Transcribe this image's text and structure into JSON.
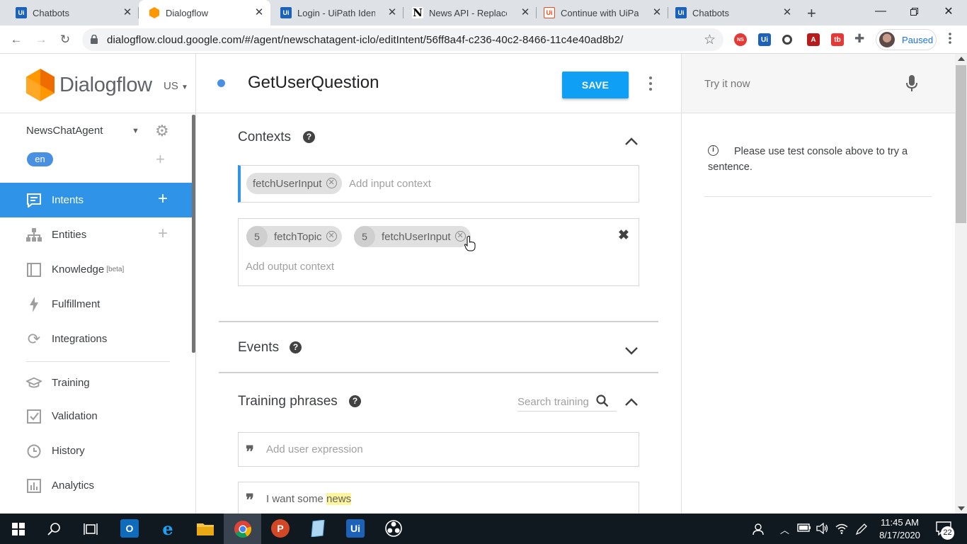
{
  "browser": {
    "tabs": [
      {
        "title": "Chatbots",
        "favicon": "uipath-icon",
        "active": false
      },
      {
        "title": "Dialogflow",
        "favicon": "dialogflow-icon",
        "active": true
      },
      {
        "title": "Login - UiPath Identi",
        "favicon": "uipath-icon",
        "active": false
      },
      {
        "title": "News API - Replacem",
        "favicon": "notion-icon",
        "active": false
      },
      {
        "title": "Continue with UiPat",
        "favicon": "uipath-orange-icon",
        "active": false
      },
      {
        "title": "Chatbots",
        "favicon": "uipath-icon",
        "active": false
      }
    ],
    "new_tab": "+",
    "url": "dialogflow.cloud.google.com/#/agent/newschatagent-iclo/editIntent/56ff8a4f-c236-40c2-8466-11c4e40ad8b2/",
    "profile_label": "Paused"
  },
  "sidebar": {
    "brand": "Dialogflow",
    "region": "US",
    "agent": "NewsChatAgent",
    "language": "en",
    "items": [
      {
        "label": "Intents",
        "icon": "chat-bubble-icon",
        "active": true,
        "plus": true
      },
      {
        "label": "Entities",
        "icon": "hierarchy-icon",
        "active": false,
        "plus": true
      },
      {
        "label": "Knowledge",
        "badge": "[beta]",
        "icon": "book-icon",
        "active": false
      },
      {
        "label": "Fulfillment",
        "icon": "lightning-icon",
        "active": false
      },
      {
        "label": "Integrations",
        "icon": "sync-icon",
        "active": false
      },
      {
        "label": "Training",
        "icon": "graduation-cap-icon",
        "active": false
      },
      {
        "label": "Validation",
        "icon": "checkbox-icon",
        "active": false
      },
      {
        "label": "History",
        "icon": "clock-icon",
        "active": false
      },
      {
        "label": "Analytics",
        "icon": "bar-chart-icon",
        "active": false
      }
    ]
  },
  "intent": {
    "title": "GetUserQuestion",
    "save_label": "SAVE",
    "contexts": {
      "title": "Contexts",
      "input_chip": "fetchUserInput",
      "input_placeholder": "Add input context",
      "output_chips": [
        {
          "lifespan": "5",
          "name": "fetchTopic"
        },
        {
          "lifespan": "5",
          "name": "fetchUserInput"
        }
      ],
      "output_placeholder": "Add output context"
    },
    "events": {
      "title": "Events"
    },
    "training": {
      "title": "Training phrases",
      "search_placeholder": "Search training",
      "add_placeholder": "Add user expression",
      "phrases": [
        {
          "prefix": "I want some ",
          "highlight": "news"
        }
      ]
    }
  },
  "console": {
    "try_placeholder": "Try it now",
    "info": "Please use test console above to try a sentence."
  },
  "taskbar": {
    "time": "11:45 AM",
    "date": "8/17/2020",
    "notifications": "22"
  },
  "colors": {
    "accent": "#2f93e8",
    "save": "#0fa0f6",
    "highlight": "#fff59d",
    "brand_orange": "#ff9800"
  }
}
